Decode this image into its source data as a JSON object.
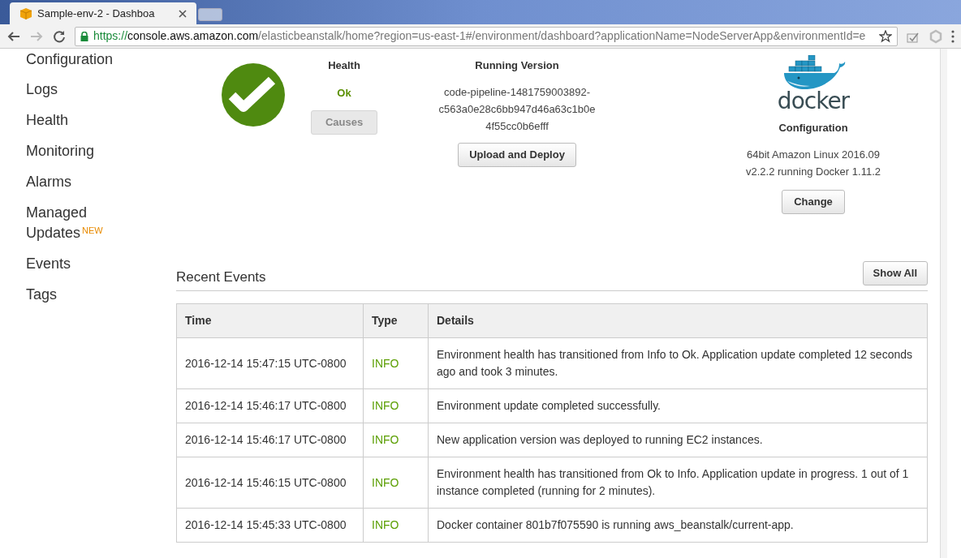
{
  "browser": {
    "tab_title": "Sample-env-2 - Dashboa",
    "url_host_prefix": "https://",
    "url_host": "console.aws.amazon.com",
    "url_path": "/elasticbeanstalk/home?region=us-east-1#/environment/dashboard?applicationName=NodeServerApp&environmentId=e"
  },
  "sidebar": {
    "items": [
      {
        "label": "Configuration"
      },
      {
        "label": "Logs"
      },
      {
        "label": "Health"
      },
      {
        "label": "Monitoring"
      },
      {
        "label": "Alarms"
      },
      {
        "label": "Managed Updates",
        "badge": "NEW"
      },
      {
        "label": "Events"
      },
      {
        "label": "Tags"
      }
    ]
  },
  "health": {
    "title": "Health",
    "status": "Ok",
    "causes_button": {
      "label": "Causes",
      "disabled": true
    }
  },
  "running_version": {
    "title": "Running Version",
    "lines": [
      "code-pipeline-1481759003892-",
      "c563a0e28c6bb947d46a63c1b0e",
      "4f55cc0b6efff"
    ],
    "button": "Upload and Deploy"
  },
  "configuration": {
    "logo_text": "docker",
    "title": "Configuration",
    "lines": [
      "64bit Amazon Linux 2016.09",
      "v2.2.2 running Docker 1.11.2"
    ],
    "button": "Change"
  },
  "recent_events": {
    "title": "Recent Events",
    "show_all": "Show All",
    "table": {
      "columns": [
        "Time",
        "Type",
        "Details"
      ],
      "rows": [
        [
          "2016-12-14 15:47:15 UTC-0800",
          "INFO",
          "Environment health has transitioned from Info to Ok. Application update completed 12 seconds ago and took 3 minutes."
        ],
        [
          "2016-12-14 15:46:17 UTC-0800",
          "INFO",
          "Environment update completed successfully."
        ],
        [
          "2016-12-14 15:46:17 UTC-0800",
          "INFO",
          "New application version was deployed to running EC2 instances."
        ],
        [
          "2016-12-14 15:46:15 UTC-0800",
          "INFO",
          "Environment health has transitioned from Ok to Info. Application update in progress. 1 out of 1 instance completed (running for 2 minutes)."
        ],
        [
          "2016-12-14 15:45:33 UTC-0800",
          "INFO",
          "Docker container 801b7f075590 is running aws_beanstalk/current-app."
        ]
      ]
    }
  }
}
